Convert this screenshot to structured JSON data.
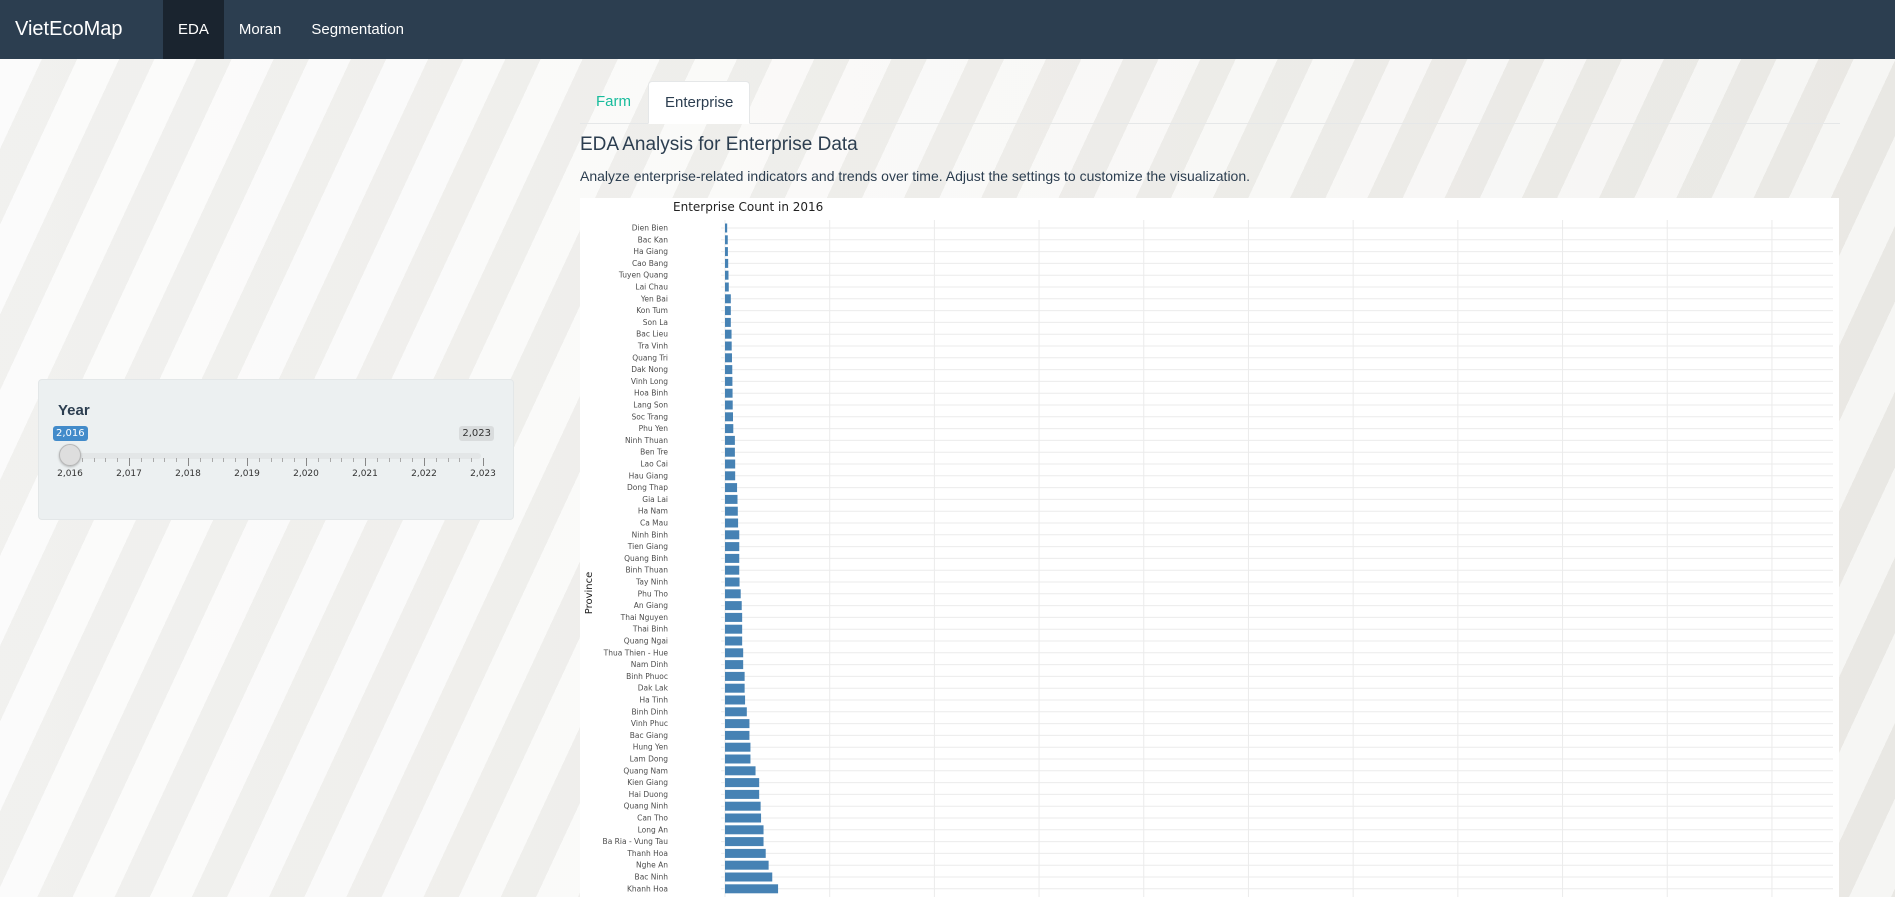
{
  "app": {
    "brand": "VietEcoMap"
  },
  "nav": {
    "items": [
      {
        "label": "EDA",
        "active": true
      },
      {
        "label": "Moran"
      },
      {
        "label": "Segmentation"
      }
    ]
  },
  "sidebar": {
    "year_label": "Year",
    "slider": {
      "from_badge": "2,016",
      "to_badge": "2,023",
      "min": 2016,
      "max": 2023,
      "value": 2016,
      "tick_labels": [
        "2,016",
        "2,017",
        "2,018",
        "2,019",
        "2,020",
        "2,021",
        "2,022",
        "2,023"
      ]
    }
  },
  "tabs": [
    {
      "label": "Farm"
    },
    {
      "label": "Enterprise",
      "active": true
    }
  ],
  "section": {
    "title": "EDA Analysis for Enterprise Data",
    "description": "Analyze enterprise-related indicators and trends over time. Adjust the settings to customize the visualization."
  },
  "colors": {
    "navbar": "#2c3e50",
    "accent": "#18bc9c",
    "bar": "#4682b4",
    "badge": "#428bca"
  },
  "chart_data": {
    "type": "bar",
    "orientation": "horizontal",
    "title": "Enterprise Count in 2016",
    "ylabel": "Province",
    "xlabel": "",
    "grid": true,
    "categories": [
      "Dien Bien",
      "Bac Kan",
      "Ha Giang",
      "Cao Bang",
      "Tuyen Quang",
      "Lai Chau",
      "Yen Bai",
      "Kon Tum",
      "Son La",
      "Bac Lieu",
      "Tra Vinh",
      "Quang Tri",
      "Dak Nong",
      "Vinh Long",
      "Hoa Binh",
      "Lang Son",
      "Soc Trang",
      "Phu Yen",
      "Ninh Thuan",
      "Ben Tre",
      "Lao Cai",
      "Hau Giang",
      "Dong Thap",
      "Gia Lai",
      "Ha Nam",
      "Ca Mau",
      "Ninh Binh",
      "Tien Giang",
      "Quang Binh",
      "Binh Thuan",
      "Tay Ninh",
      "Phu Tho",
      "An Giang",
      "Thai Nguyen",
      "Thai Binh",
      "Quang Ngai",
      "Thua Thien - Hue",
      "Nam Dinh",
      "Binh Phuoc",
      "Dak Lak",
      "Ha Tinh",
      "Binh Dinh",
      "Vinh Phuc",
      "Bac Giang",
      "Hung Yen",
      "Lam Dong",
      "Quang Nam",
      "Kien Giang",
      "Hai Duong",
      "Quang Ninh",
      "Can Tho",
      "Long An",
      "Ba Ria - Vung Tau",
      "Thanh Hoa",
      "Nghe An",
      "Bac Ninh",
      "Khanh Hoa"
    ],
    "values": [
      1.5,
      1.9,
      2.0,
      2.2,
      2.4,
      2.6,
      4.0,
      4.0,
      4.0,
      4.5,
      4.6,
      4.8,
      5.0,
      5.1,
      5.2,
      5.3,
      5.5,
      5.7,
      6.8,
      6.8,
      7.0,
      7.0,
      8.3,
      8.6,
      8.8,
      9.0,
      9.8,
      9.8,
      9.8,
      9.8,
      10.0,
      10.8,
      11.5,
      11.8,
      11.8,
      11.8,
      12.5,
      12.5,
      13.5,
      13.5,
      13.8,
      15.0,
      16.8,
      16.8,
      17.5,
      17.5,
      21.0,
      23.5,
      23.5,
      24.5,
      24.8,
      26.5,
      26.5,
      28.0,
      30.0,
      32.5,
      36.5
    ],
    "xlim": [
      0,
      762
    ]
  }
}
